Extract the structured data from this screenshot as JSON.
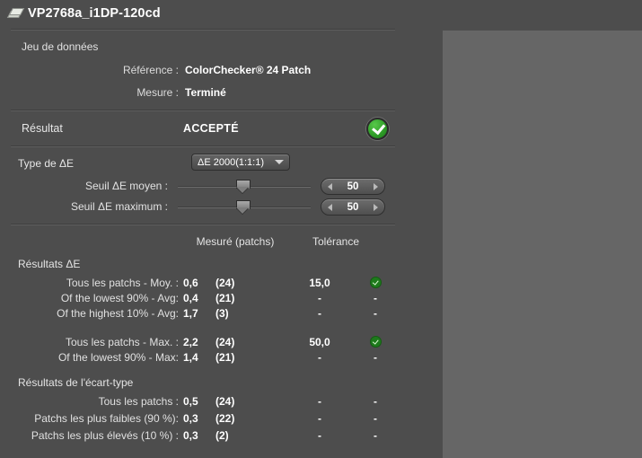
{
  "window": {
    "title": "VP2768a_i1DP-120cd",
    "title_icon": "color-patch-stack-icon"
  },
  "dataset": {
    "heading": "Jeu de données",
    "reference_label": "Référence :",
    "reference_value": "ColorChecker® 24 Patch",
    "measure_label": "Mesure :",
    "measure_value": "Terminé"
  },
  "result": {
    "label": "Résultat",
    "value": "ACCEPTÉ",
    "badge_icon": "green-check-circle-icon",
    "badge_color": "#2e9c27"
  },
  "delta_e": {
    "type_label": "Type de ΔE",
    "selected": "ΔE 2000(1:1:1)",
    "dropdown_icon": "chevron-down-icon",
    "mean_threshold_label": "Seuil ΔE moyen :",
    "mean_threshold_value": "50",
    "max_threshold_label": "Seuil ΔE maximum :",
    "max_threshold_value": "50",
    "stepper_left_icon": "arrow-left-icon",
    "stepper_right_icon": "arrow-right-icon"
  },
  "table": {
    "columns": {
      "measured": "Mesuré (patchs)",
      "tolerance": "Tolérance"
    },
    "sections": [
      {
        "title": "Résultats ΔE",
        "rows": [
          {
            "label": "Tous les patchs - Moy. :",
            "measured": "0,6",
            "count": "(24)",
            "tolerance": "15,0",
            "status": "ok"
          },
          {
            "label": "Of the lowest 90% - Avg:",
            "measured": "0,4",
            "count": "(21)",
            "tolerance": "-",
            "status": "-"
          },
          {
            "label": "Of the highest 10% - Avg:",
            "measured": "1,7",
            "count": "(3)",
            "tolerance": "-",
            "status": "-"
          },
          {
            "label": "",
            "measured": "",
            "count": "",
            "tolerance": "",
            "status": "",
            "spacer": true
          },
          {
            "label": "Tous les patchs - Max. :",
            "measured": "2,2",
            "count": "(24)",
            "tolerance": "50,0",
            "status": "ok"
          },
          {
            "label": "Of the lowest 90% - Max:",
            "measured": "1,4",
            "count": "(21)",
            "tolerance": "-",
            "status": "-"
          }
        ]
      },
      {
        "title": "Résultats de l'écart-type",
        "rows": [
          {
            "label": "Tous les patchs :",
            "measured": "0,5",
            "count": "(24)",
            "tolerance": "-",
            "status": "-"
          },
          {
            "label": "Patchs les plus faibles (90 %):",
            "measured": "0,3",
            "count": "(22)",
            "tolerance": "-",
            "status": "-"
          },
          {
            "label": "Patchs les plus élevés (10 %) :",
            "measured": "0,3",
            "count": "(2)",
            "tolerance": "-",
            "status": "-"
          }
        ]
      }
    ]
  },
  "theme": {
    "background": "#4d4d4d",
    "panel_background": "#666666",
    "text": "#e2e2e2",
    "value_text": "#ffffff"
  }
}
